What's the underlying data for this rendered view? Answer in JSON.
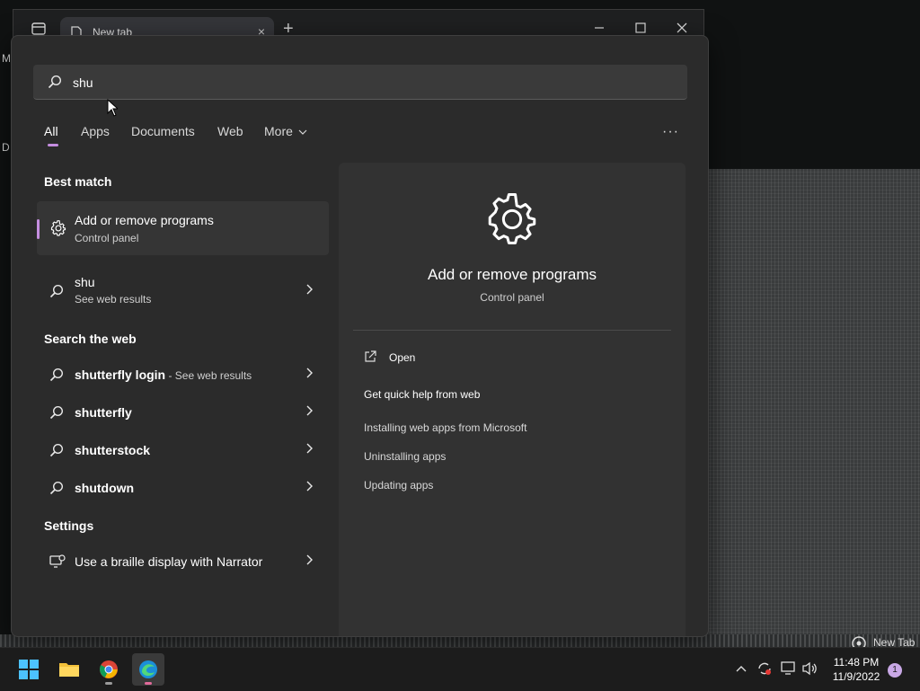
{
  "desktop": {
    "left_letters": [
      "M",
      "D"
    ],
    "newtab_label": "New Tab"
  },
  "browser": {
    "tab_title": "New tab",
    "new_tab_glyph": "+",
    "close_tab_glyph": "×"
  },
  "search": {
    "query": "shu",
    "tabs": [
      "All",
      "Apps",
      "Documents",
      "Web",
      "More"
    ],
    "active_tab": "All",
    "more_options": "···"
  },
  "results": {
    "best_match_heading": "Best match",
    "best_match": {
      "title": "Add or remove programs",
      "subtitle": "Control panel"
    },
    "web_query": {
      "title": "shu",
      "subtitle": "See web results"
    },
    "search_web_heading": "Search the web",
    "web_suggestions": [
      {
        "bold": "shutterfly login",
        "suffix": " - See web results"
      },
      {
        "bold": "shutterfly",
        "suffix": ""
      },
      {
        "bold": "shutterstock",
        "suffix": ""
      },
      {
        "bold": "shutdown",
        "suffix": ""
      }
    ],
    "settings_heading": "Settings",
    "settings_item": "Use a braille display with Narrator"
  },
  "detail": {
    "title": "Add or remove programs",
    "subtitle": "Control panel",
    "open_label": "Open",
    "help_heading": "Get quick help from web",
    "help_links": [
      "Installing web apps from Microsoft",
      "Uninstalling apps",
      "Updating apps"
    ]
  },
  "taskbar": {
    "time": "11:48 PM",
    "date": "11/9/2022",
    "notification_count": "1",
    "apps": [
      "windows-start-icon",
      "file-explorer-icon",
      "chrome-icon",
      "edge-icon"
    ]
  },
  "colors": {
    "accent": "#c58ee0",
    "flyout_bg": "#2b2b2b",
    "detail_bg": "#323232",
    "taskbar_bg": "#1c1c1c"
  }
}
